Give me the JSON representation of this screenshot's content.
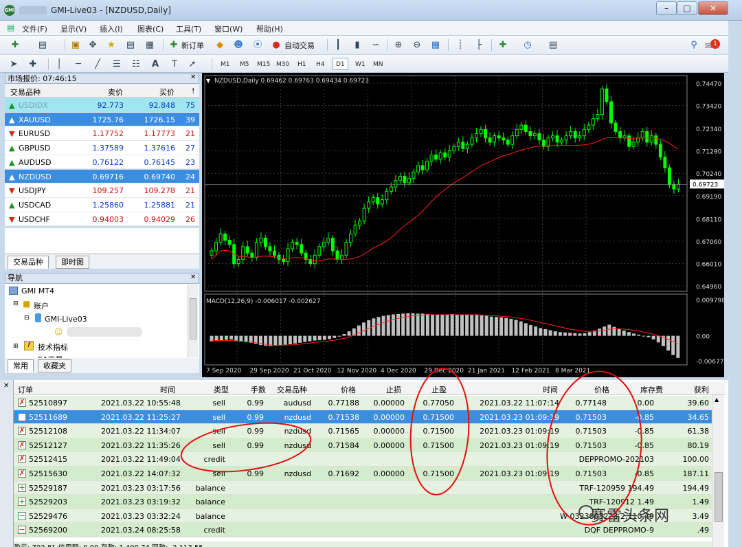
{
  "window": {
    "title": "GMI-Live03 - [NZDUSD,Daily]",
    "app_icon": "GMI"
  },
  "menu": [
    "文件(F)",
    "显示(V)",
    "插入(I)",
    "图表(C)",
    "工具(T)",
    "窗口(W)",
    "帮助(H)"
  ],
  "toolbar": {
    "new_order": "新订单",
    "auto_trade": "自动交易",
    "notifications": "1",
    "timeframes": [
      "M1",
      "M5",
      "M15",
      "M30",
      "H1",
      "H4",
      "D1",
      "W1",
      "MN"
    ],
    "active_tf": "D1"
  },
  "market_watch": {
    "title": "市场报价: 07:46:15",
    "headers": {
      "symbol": "交易品种",
      "bid": "卖价",
      "ask": "买价",
      "spread": "!"
    },
    "rows": [
      {
        "symbol": "USDIDX",
        "bid": "92.773",
        "ask": "92.848",
        "spread": "75",
        "dir": "up",
        "state": "hl"
      },
      {
        "symbol": "XAUUSD",
        "bid": "1725.76",
        "ask": "1726.15",
        "spread": "39",
        "dir": "up",
        "state": "sel"
      },
      {
        "symbol": "EURUSD",
        "bid": "1.17752",
        "ask": "1.17773",
        "spread": "21",
        "dir": "down",
        "state": ""
      },
      {
        "symbol": "GBPUSD",
        "bid": "1.37589",
        "ask": "1.37616",
        "spread": "27",
        "dir": "up",
        "state": ""
      },
      {
        "symbol": "AUDUSD",
        "bid": "0.76122",
        "ask": "0.76145",
        "spread": "23",
        "dir": "up",
        "state": ""
      },
      {
        "symbol": "NZDUSD",
        "bid": "0.69716",
        "ask": "0.69740",
        "spread": "24",
        "dir": "up",
        "state": "sel"
      },
      {
        "symbol": "USDJPY",
        "bid": "109.257",
        "ask": "109.278",
        "spread": "21",
        "dir": "down",
        "state": ""
      },
      {
        "symbol": "USDCAD",
        "bid": "1.25860",
        "ask": "1.25881",
        "spread": "21",
        "dir": "up",
        "state": ""
      },
      {
        "symbol": "USDCHF",
        "bid": "0.94003",
        "ask": "0.94029",
        "spread": "26",
        "dir": "down",
        "state": ""
      }
    ],
    "tabs": [
      "交易品种",
      "即时图"
    ]
  },
  "navigator": {
    "title": "导航",
    "items": [
      "GMI MT4",
      "账户",
      "GMI-Live03",
      "技术指标",
      "EA交易"
    ],
    "tabs": [
      "常用",
      "收藏夹"
    ]
  },
  "chart_data": {
    "type": "candlestick",
    "title": "NZDUSD,Daily  0.69462 0.69763 0.69434 0.69723",
    "price_label": "0.69723",
    "y_ticks": [
      "0.74470",
      "0.73420",
      "0.72340",
      "0.71290",
      "0.70240",
      "0.69190",
      "0.68110",
      "0.67060",
      "0.66010",
      "0.64960"
    ],
    "ylim": [
      0.6496,
      0.7463
    ],
    "x_ticks": [
      "7 Sep 2020",
      "29 Sep 2020",
      "21 Oct 2020",
      "12 Nov 2020",
      "4 Dec 2020",
      "29 Dec 2020",
      "21 Jan 2021",
      "12 Feb 2021",
      "8 Mar 2021"
    ],
    "close": [
      0.666,
      0.67,
      0.674,
      0.671,
      0.669,
      0.66,
      0.662,
      0.668,
      0.665,
      0.663,
      0.67,
      0.672,
      0.668,
      0.666,
      0.664,
      0.662,
      0.661,
      0.667,
      0.67,
      0.669,
      0.665,
      0.662,
      0.66,
      0.664,
      0.668,
      0.67,
      0.672,
      0.666,
      0.662,
      0.664,
      0.67,
      0.674,
      0.678,
      0.68,
      0.686,
      0.689,
      0.691,
      0.688,
      0.69,
      0.694,
      0.696,
      0.699,
      0.701,
      0.698,
      0.7,
      0.703,
      0.706,
      0.704,
      0.708,
      0.711,
      0.709,
      0.712,
      0.71,
      0.713,
      0.715,
      0.717,
      0.714,
      0.716,
      0.719,
      0.721,
      0.723,
      0.719,
      0.717,
      0.72,
      0.719,
      0.718,
      0.716,
      0.72,
      0.723,
      0.725,
      0.722,
      0.72,
      0.721,
      0.718,
      0.715,
      0.719,
      0.72,
      0.717,
      0.718,
      0.72,
      0.722,
      0.719,
      0.72,
      0.723,
      0.725,
      0.728,
      0.73,
      0.742,
      0.736,
      0.726,
      0.722,
      0.719,
      0.72,
      0.715,
      0.717,
      0.719,
      0.722,
      0.717,
      0.72,
      0.716,
      0.71,
      0.705,
      0.697,
      0.695,
      0.6972
    ],
    "macd_label": "MACD(12,26,9) -0.006017 -0.002627",
    "macd_ticks": [
      "0.009798",
      "0.00",
      "-0.00677"
    ],
    "macd_ylim": [
      -0.00677,
      0.009798
    ],
    "macd_hist": [
      -0.0015,
      -0.0014,
      -0.0012,
      -0.0011,
      -0.001,
      -0.0013,
      -0.0015,
      -0.0017,
      -0.0019,
      -0.0022,
      -0.0025,
      -0.0027,
      -0.0028,
      -0.0027,
      -0.0025,
      -0.0024,
      -0.0023,
      -0.0021,
      -0.0019,
      -0.0017,
      -0.0015,
      -0.0013,
      -0.0012,
      -0.0011,
      -0.0009,
      -0.0006,
      -0.0002,
      0.0005,
      0.0012,
      0.002,
      0.0028,
      0.0036,
      0.0042,
      0.0047,
      0.0051,
      0.0054,
      0.0056,
      0.0058,
      0.0059,
      0.006,
      0.0061,
      0.0061,
      0.006,
      0.006,
      0.0059,
      0.0058,
      0.0057,
      0.0057,
      0.0058,
      0.0059,
      0.0058,
      0.0057,
      0.0057,
      0.0056,
      0.0056,
      0.0055,
      0.0054,
      0.0052,
      0.0051,
      0.005,
      0.0048,
      0.0046,
      0.0043,
      0.0039,
      0.0034,
      0.0029,
      0.0025,
      0.0021,
      0.0018,
      0.0015,
      0.0012,
      0.001,
      0.0009,
      0.0008,
      0.0007,
      0.0006,
      0.0007,
      0.001,
      0.0014,
      0.0019,
      0.0025,
      0.003,
      0.0024,
      0.0018,
      0.0014,
      0.001,
      0.0006,
      0.0003,
      0.0,
      -0.0004,
      -0.001,
      -0.0018,
      -0.0028,
      -0.004,
      -0.0052,
      -0.006
    ],
    "macd_signal": [
      -0.0012,
      -0.0013,
      -0.0013,
      -0.0013,
      -0.0013,
      -0.0014,
      -0.0015,
      -0.0016,
      -0.0017,
      -0.0019,
      -0.0021,
      -0.0023,
      -0.0025,
      -0.0026,
      -0.0026,
      -0.0025,
      -0.0025,
      -0.0024,
      -0.0023,
      -0.0021,
      -0.002,
      -0.0018,
      -0.0017,
      -0.0015,
      -0.0014,
      -0.0012,
      -0.001,
      -0.0007,
      -0.0003,
      0.0002,
      0.0008,
      0.0014,
      0.002,
      0.0026,
      0.0031,
      0.0036,
      0.004,
      0.0044,
      0.0047,
      0.005,
      0.0052,
      0.0054,
      0.0055,
      0.0056,
      0.0057,
      0.0057,
      0.0057,
      0.0057,
      0.0057,
      0.0057,
      0.0057,
      0.0057,
      0.0057,
      0.0057,
      0.0057,
      0.0056,
      0.0056,
      0.0055,
      0.0054,
      0.0053,
      0.0052,
      0.0051,
      0.0049,
      0.0047,
      0.0045,
      0.0042,
      0.0039,
      0.0036,
      0.0033,
      0.003,
      0.0027,
      0.0024,
      0.0021,
      0.0018,
      0.0016,
      0.0014,
      0.0012,
      0.0012,
      0.0012,
      0.0013,
      0.0015,
      0.0018,
      0.0019,
      0.0019,
      0.0018,
      0.0017,
      0.0015,
      0.0013,
      0.001,
      0.0007,
      0.0004,
      0.0,
      -0.0004,
      -0.001,
      -0.0016,
      -0.0022
    ]
  },
  "terminal": {
    "headers": [
      "订单",
      "时间",
      "类型",
      "手数",
      "交易品种",
      "价格",
      "止损",
      "止盈",
      "时间",
      "价格",
      "库存费",
      "获利"
    ],
    "rows": [
      {
        "order": "52510897",
        "time": "2021.03.22 10:55:48",
        "type": "sell",
        "lots": "0.99",
        "symbol": "audusd",
        "price": "0.77188",
        "sl": "0.00000",
        "tp": "0.77050",
        "ctime": "2021.03.22 11:07:14",
        "cprice": "0.77148",
        "swap": "0.00",
        "profit": "39.60",
        "comment": "",
        "icon": "x"
      },
      {
        "order": "52511689",
        "time": "2021.03.22 11:25:27",
        "type": "sell",
        "lots": "0.99",
        "symbol": "nzdusd",
        "price": "0.71538",
        "sl": "0.00000",
        "tp": "0.71500",
        "ctime": "2021.03.23 01:09:19",
        "cprice": "0.71503",
        "swap": "-0.85",
        "profit": "34.65",
        "comment": "",
        "icon": "x",
        "sel": true
      },
      {
        "order": "52512108",
        "time": "2021.03.22 11:34:07",
        "type": "sell",
        "lots": "0.99",
        "symbol": "nzdusd",
        "price": "0.71565",
        "sl": "0.00000",
        "tp": "0.71500",
        "ctime": "2021.03.23 01:09:19",
        "cprice": "0.71503",
        "swap": "-0.85",
        "profit": "61.38",
        "comment": "",
        "icon": "x"
      },
      {
        "order": "52512127",
        "time": "2021.03.22 11:35:26",
        "type": "sell",
        "lots": "0.99",
        "symbol": "nzdusd",
        "price": "0.71584",
        "sl": "0.00000",
        "tp": "0.71500",
        "ctime": "2021.03.23 01:09:19",
        "cprice": "0.71503",
        "swap": "-0.85",
        "profit": "80.19",
        "comment": "",
        "icon": "x"
      },
      {
        "order": "52512415",
        "time": "2021.03.22 11:49:04",
        "type": "credit",
        "lots": "",
        "symbol": "",
        "price": "",
        "sl": "",
        "tp": "",
        "ctime": "",
        "cprice": "",
        "swap": "",
        "profit": "100.00",
        "comment": "DEPPROMO-202103",
        "icon": "x"
      },
      {
        "order": "52515630",
        "time": "2021.03.22 14:07:32",
        "type": "sell",
        "lots": "0.99",
        "symbol": "nzdusd",
        "price": "0.71692",
        "sl": "0.00000",
        "tp": "0.71500",
        "ctime": "2021.03.23 01:09:19",
        "cprice": "0.71503",
        "swap": "-0.85",
        "profit": "187.11",
        "comment": "",
        "icon": "x"
      },
      {
        "order": "52529187",
        "time": "2021.03.23 03:17:56",
        "type": "balance",
        "lots": "",
        "symbol": "",
        "price": "",
        "sl": "",
        "tp": "",
        "ctime": "",
        "cprice": "",
        "swap": "",
        "profit": "194.49",
        "comment": "TRF-120959 194.49",
        "icon": "plus"
      },
      {
        "order": "52529203",
        "time": "2021.03.23 03:19:32",
        "type": "balance",
        "lots": "",
        "symbol": "",
        "price": "",
        "sl": "",
        "tp": "",
        "ctime": "",
        "cprice": "",
        "swap": "",
        "profit": "1.49",
        "comment": "TRF-120912 1.49",
        "icon": "plus"
      },
      {
        "order": "52529476",
        "time": "2021.03.23 03:32:24",
        "type": "balance",
        "lots": "",
        "symbol": "",
        "price": "",
        "sl": "",
        "tp": "",
        "ctime": "",
        "cprice": "",
        "swap": "",
        "profit": "3.49",
        "comment": "W-0323003223 2,110.49",
        "icon": "minus"
      },
      {
        "order": "52569200",
        "time": "2021.03.24 08:25:58",
        "type": "credit",
        "lots": "",
        "symbol": "",
        "price": "",
        "sl": "",
        "tp": "",
        "ctime": "",
        "cprice": "",
        "swap": "",
        "profit": ".49",
        "comment": "DQF DEPPROMO-9",
        "icon": "minus"
      }
    ],
    "summary": "盈亏: 702.81  信用额: 0.00  存款: 1,400.74  取款: -2,113.55"
  },
  "watermark": "赛雷头条网",
  "colors": {
    "bull": "#00ff00",
    "bear": "#00ff00",
    "ma": "#ff2020",
    "hist": "#c0c0c0",
    "signal": "#ff2020",
    "annotation": "#e01010"
  }
}
